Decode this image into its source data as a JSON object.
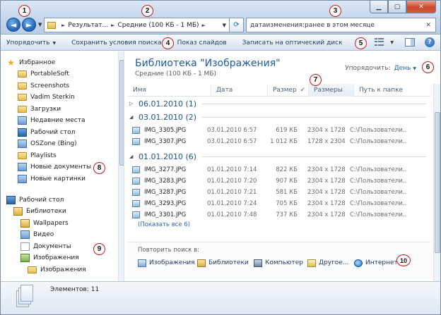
{
  "window": {
    "controls": {
      "minimize": "▁",
      "maximize": "▢",
      "close": "✕"
    }
  },
  "nav": {
    "back": "◄",
    "forward": "►",
    "history_drop": "▼"
  },
  "address": {
    "crumbs": [
      "Результат...",
      "Средние (100 КБ - 1 МБ)"
    ],
    "separator": "►",
    "refresh": "⟳"
  },
  "search": {
    "query": "датаизменения:ранее в этом месяце",
    "clear": "✕"
  },
  "toolbar": {
    "organize": "Упорядочить",
    "save_search": "Сохранить условия поиска",
    "slideshow": "Показ слайдов",
    "burn": "Записать на оптический диск"
  },
  "navpane": {
    "favorites": [
      {
        "label": "Избранное",
        "icon": "star-icon",
        "head": true
      },
      {
        "label": "PortableSoft",
        "icon": "folder-icon"
      },
      {
        "label": "Screenshots",
        "icon": "folder-icon"
      },
      {
        "label": "Vadim Sterkin",
        "icon": "folder-icon"
      },
      {
        "label": "Загрузки",
        "icon": "folder-icon"
      },
      {
        "label": "Недавние места",
        "icon": "recent-places-icon"
      },
      {
        "label": "Рабочий стол",
        "icon": "desktop-icon"
      },
      {
        "label": "OSZone (Bing)",
        "icon": "search-connector-icon"
      },
      {
        "label": "Playlists",
        "icon": "folder-icon"
      },
      {
        "label": "Новые документы",
        "icon": "saved-search-icon"
      },
      {
        "label": "Новые картинки",
        "icon": "saved-search-icon"
      }
    ],
    "tree": [
      {
        "label": "Рабочий стол",
        "icon": "desktop-icon",
        "indent": 0
      },
      {
        "label": "Библиотеки",
        "icon": "libraries-icon",
        "indent": 1
      },
      {
        "label": "Wallpapers",
        "icon": "library-icon",
        "indent": 2
      },
      {
        "label": "Видео",
        "icon": "video-library-icon",
        "indent": 2
      },
      {
        "label": "Документы",
        "icon": "documents-library-icon",
        "indent": 2
      },
      {
        "label": "Изображения",
        "icon": "pictures-library-icon",
        "indent": 2
      },
      {
        "label": "Изображения",
        "icon": "folder-icon",
        "indent": 3
      }
    ]
  },
  "content": {
    "title": "Библиотека \"Изображения\"",
    "subtitle": "Средние (100 КБ - 1 МБ)",
    "arrange_label": "Упорядочить:",
    "arrange_value": "День",
    "columns": [
      "Имя",
      "Дата",
      "Размер",
      "Размеры",
      "Путь к папке"
    ],
    "sort_mark": "✓",
    "groups": [
      {
        "label": "06.01.2010 (1)",
        "expanded": false,
        "files": []
      },
      {
        "label": "03.01.2010 (2)",
        "expanded": true,
        "files": [
          {
            "name": "IMG_3305.JPG",
            "date": "03.01.2010 6:57",
            "size": "619 КБ",
            "dims": "2304 x 1728",
            "path": "C:\\Пользователи..."
          },
          {
            "name": "IMG_3307.JPG",
            "date": "03.01.2010 6:57",
            "size": "1 012 КБ",
            "dims": "1728 x 2304",
            "path": "C:\\Пользователи..."
          }
        ]
      },
      {
        "label": "01.01.2010 (6)",
        "expanded": true,
        "files": [
          {
            "name": "IMG_3277.JPG",
            "date": "01.01.2010 7:14",
            "size": "822 КБ",
            "dims": "2304 x 1728",
            "path": "C:\\Пользователи..."
          },
          {
            "name": "IMG_3283.JPG",
            "date": "01.01.2010 7:20",
            "size": "907 КБ",
            "dims": "2304 x 1728",
            "path": "C:\\Пользователи..."
          },
          {
            "name": "IMG_3287.JPG",
            "date": "01.01.2010 7:21",
            "size": "581 КБ",
            "dims": "2304 x 1728",
            "path": "C:\\Пользователи..."
          },
          {
            "name": "IMG_3293.JPG",
            "date": "01.01.2010 7:24",
            "size": "705 КБ",
            "dims": "2304 x 1728",
            "path": "C:\\Пользователи..."
          },
          {
            "name": "IMG_3301.JPG",
            "date": "01.01.2010 7:48",
            "size": "737 КБ",
            "dims": "2304 x 1728",
            "path": "C:\\Пользователи..."
          }
        ]
      }
    ],
    "show_all": "(Показать все 6)",
    "search_again_label": "Повторить поиск в:",
    "search_again": [
      {
        "label": "Изображения",
        "icon": "pictures-icon"
      },
      {
        "label": "Библиотеки",
        "icon": "libraries-icon"
      },
      {
        "label": "Компьютер",
        "icon": "computer-icon"
      },
      {
        "label": "Другое...",
        "icon": "custom-location-icon"
      },
      {
        "label": "Интернет",
        "icon": "internet-icon"
      }
    ]
  },
  "details": {
    "count": "Элементов: 11"
  },
  "markers": [
    "1",
    "2",
    "3",
    "4",
    "5",
    "6",
    "7",
    "8",
    "9",
    "10"
  ]
}
